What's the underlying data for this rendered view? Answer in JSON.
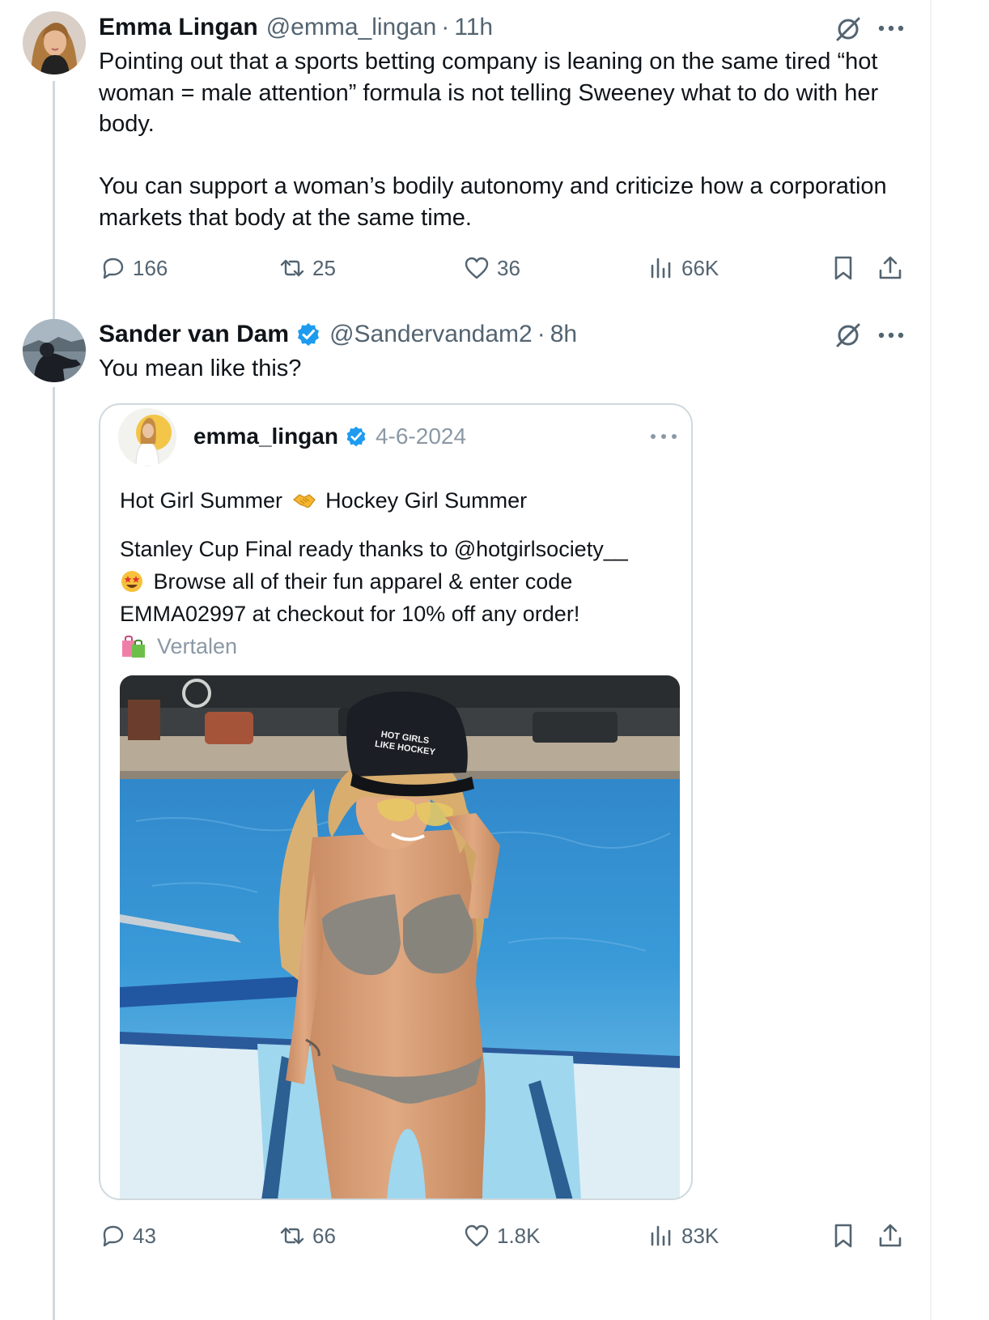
{
  "colors": {
    "text": "#0f1419",
    "secondary": "#536471",
    "verified": "#1d9bf0",
    "border": "#cfd9de"
  },
  "tweets": [
    {
      "name": "Emma Lingan",
      "handle": "@emma_lingan",
      "separator": "·",
      "time": "11h",
      "verified": false,
      "text_paragraphs": [
        "Pointing out that a sports betting company is leaning on the same tired “hot woman = male attention” formula is not telling Sweeney what to do with her body.",
        "You can support a woman’s bodily autonomy and criticize how a corporation markets that body at the same time."
      ],
      "stats": {
        "replies": "166",
        "reposts": "25",
        "likes": "36",
        "views": "66K"
      },
      "icons": [
        "grok-icon",
        "more-icon",
        "reply-icon",
        "repost-icon",
        "like-icon",
        "views-icon",
        "bookmark-icon",
        "share-icon"
      ]
    },
    {
      "name": "Sander van Dam",
      "handle": "@Sandervandam2",
      "separator": "·",
      "time": "8h",
      "verified": true,
      "text": "You mean like this?",
      "stats": {
        "replies": "43",
        "reposts": "66",
        "likes": "1.8K",
        "views": "83K"
      },
      "quoted_post": {
        "name": "emma_lingan",
        "verified": true,
        "date": "4-6-2024",
        "line1_a": "Hot Girl Summer",
        "line1_emoji": "handshake",
        "line1_b": "Hockey Girl Summer",
        "line2": "Stanley Cup Final ready thanks to @hotgirlsociety__",
        "line3_emoji": "star-struck",
        "line3": "Browse all of their fun apparel & enter code",
        "line4": "EMMA02997 at checkout for 10% off any order!",
        "translate_emoji": "shopping-bags",
        "translate": "Vertalen",
        "photo": {
          "description_icon": "pool-photo",
          "cap_text_1": "HOT GIRLS",
          "cap_text_2": "LIKE HOCKEY"
        }
      }
    }
  ]
}
